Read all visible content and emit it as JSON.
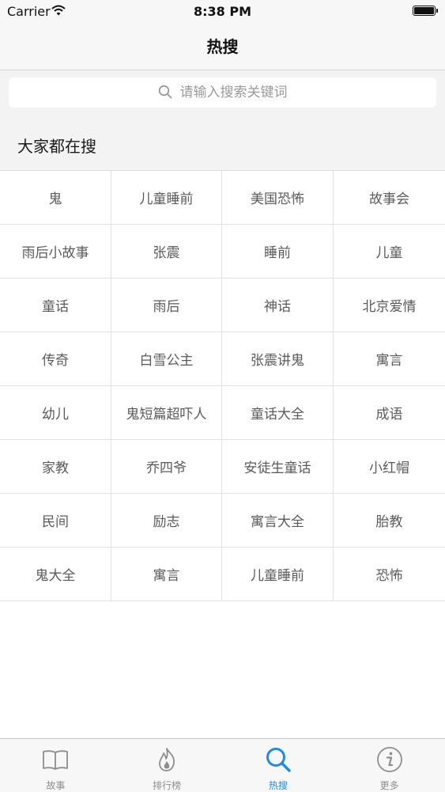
{
  "status_bar": {
    "carrier": "Carrier",
    "time": "8:38 PM"
  },
  "nav": {
    "title": "热搜"
  },
  "search": {
    "placeholder": "请输入搜索关键词"
  },
  "section": {
    "title": "大家都在搜"
  },
  "hot_terms": [
    "鬼",
    "儿童睡前",
    "美国恐怖",
    "故事会",
    "雨后小故事",
    "张震",
    "睡前",
    "儿童",
    "童话",
    "雨后",
    "神话",
    "北京爱情",
    "传奇",
    "白雪公主",
    "张震讲鬼",
    "寓言",
    "幼儿",
    "鬼短篇超吓人",
    "童话大全",
    "成语",
    "家教",
    "乔四爷",
    "安徒生童话",
    "小红帽",
    "民间",
    "励志",
    "寓言大全",
    "胎教",
    "鬼大全",
    "寓言",
    "儿童睡前",
    "恐怖"
  ],
  "tabs": [
    {
      "label": "故事",
      "icon": "book-icon",
      "active": false
    },
    {
      "label": "排行榜",
      "icon": "flame-icon",
      "active": false
    },
    {
      "label": "热搜",
      "icon": "search-icon",
      "active": true
    },
    {
      "label": "更多",
      "icon": "info-icon",
      "active": false
    }
  ],
  "colors": {
    "accent": "#1f8ae8",
    "inactive": "#8e8e8e",
    "bar_background": "#f7f7f7"
  }
}
